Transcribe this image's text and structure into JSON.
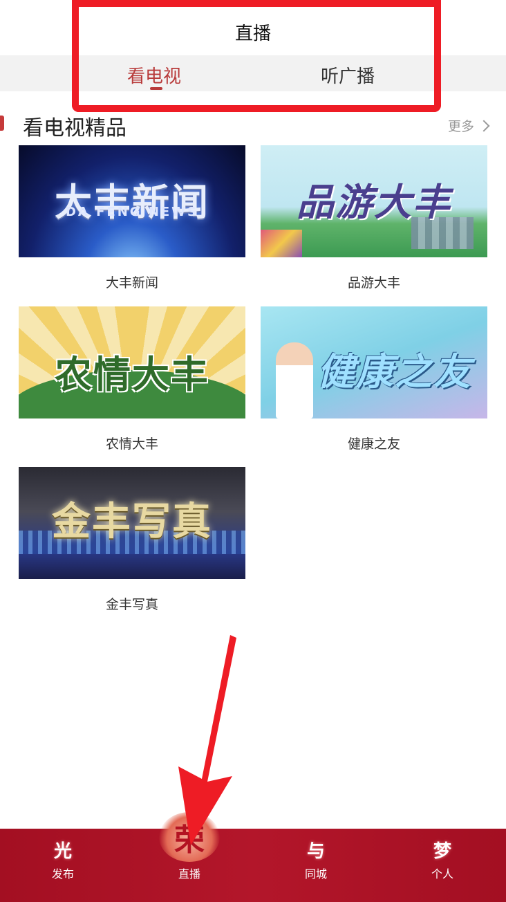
{
  "header": {
    "title": "直播"
  },
  "tabs": [
    {
      "label": "看电视",
      "active": true
    },
    {
      "label": "听广播",
      "active": false
    }
  ],
  "section": {
    "title": "看电视精品",
    "more_label": "更多"
  },
  "programs": [
    {
      "title": "大丰新闻",
      "thumb_text": "大丰新闻",
      "thumb_sub": "DA FENG NEWS"
    },
    {
      "title": "品游大丰",
      "thumb_text": "品游大丰"
    },
    {
      "title": "农情大丰",
      "thumb_text": "农情大丰"
    },
    {
      "title": "健康之友",
      "thumb_text": "健康之友"
    },
    {
      "title": "金丰写真",
      "thumb_text": "金丰写真"
    }
  ],
  "bottom_nav": [
    {
      "glyph": "光",
      "label": "发布"
    },
    {
      "glyph": "荣",
      "label": "直播"
    },
    {
      "glyph": "与",
      "label": "同城"
    },
    {
      "glyph": "梦",
      "label": "个人"
    }
  ],
  "colors": {
    "accent": "#b83a3a",
    "nav_bg": "#a30f22",
    "highlight": "#ee1c25"
  }
}
